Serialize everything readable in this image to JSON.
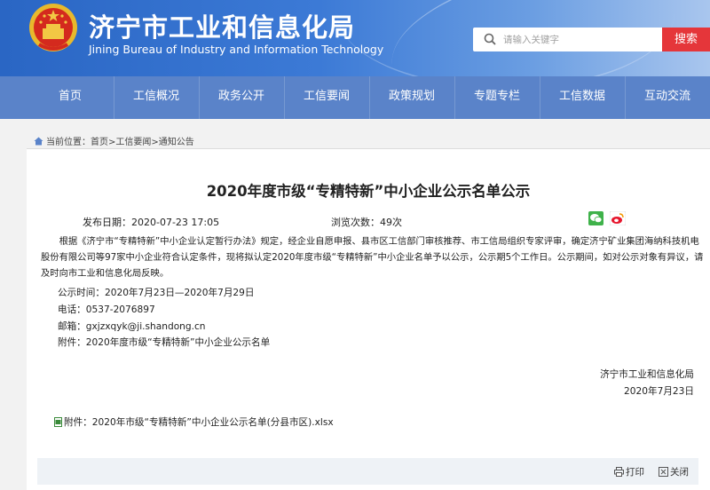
{
  "header": {
    "title": "济宁市工业和信息化局",
    "subtitle": "Jining Bureau of Industry and Information Technology",
    "emblem_icon": "national-emblem-icon"
  },
  "search": {
    "placeholder": "请输入关键字",
    "button_label": "搜索"
  },
  "nav": {
    "items": [
      {
        "label": "首页"
      },
      {
        "label": "工信概况"
      },
      {
        "label": "政务公开"
      },
      {
        "label": "工信要闻"
      },
      {
        "label": "政策规划"
      },
      {
        "label": "专题专栏"
      },
      {
        "label": "工信数据"
      },
      {
        "label": "互动交流"
      }
    ]
  },
  "breadcrumb": {
    "text": "当前位置：首页>工信要闻>通知公告"
  },
  "article": {
    "title": "2020年度市级“专精特新”中小企业公示名单公示",
    "publish_date": "发布日期：2020-07-23 17:05",
    "views": "浏览次数：49次",
    "body": "根据《济宁市“专精特新”中小企业认定暂行办法》规定，经企业自愿申报、县市区工信部门审核推荐、市工信局组织专家评审，确定济宁矿业集团海纳科技机电股份有限公司等97家中小企业符合认定条件，现将拟认定2020年度市级“专精特新”中小企业名单予以公示，公示期5个工作日。公示期间，如对公示对象有异议，请及时向市工业和信息化局反映。",
    "lines": [
      "公示时间：2020年7月23日—2020年7月29日",
      "电话：0537-2076897",
      "邮箱：gxjzxqyk@ji.shandong.cn",
      "附件：2020年度市级“专精特新”中小企业公示名单"
    ],
    "signature": {
      "org": "济宁市工业和信息化局",
      "date": "2020年7月23日"
    },
    "attachment": "附件：2020年市级“专精特新”中小企业公示名单(分县市区).xlsx"
  },
  "tools": {
    "print": "打印",
    "close": "关闭"
  },
  "colors": {
    "header_blue": "#2a66c4",
    "nav_blue": "#5a83c9",
    "search_red": "#e5363a"
  }
}
